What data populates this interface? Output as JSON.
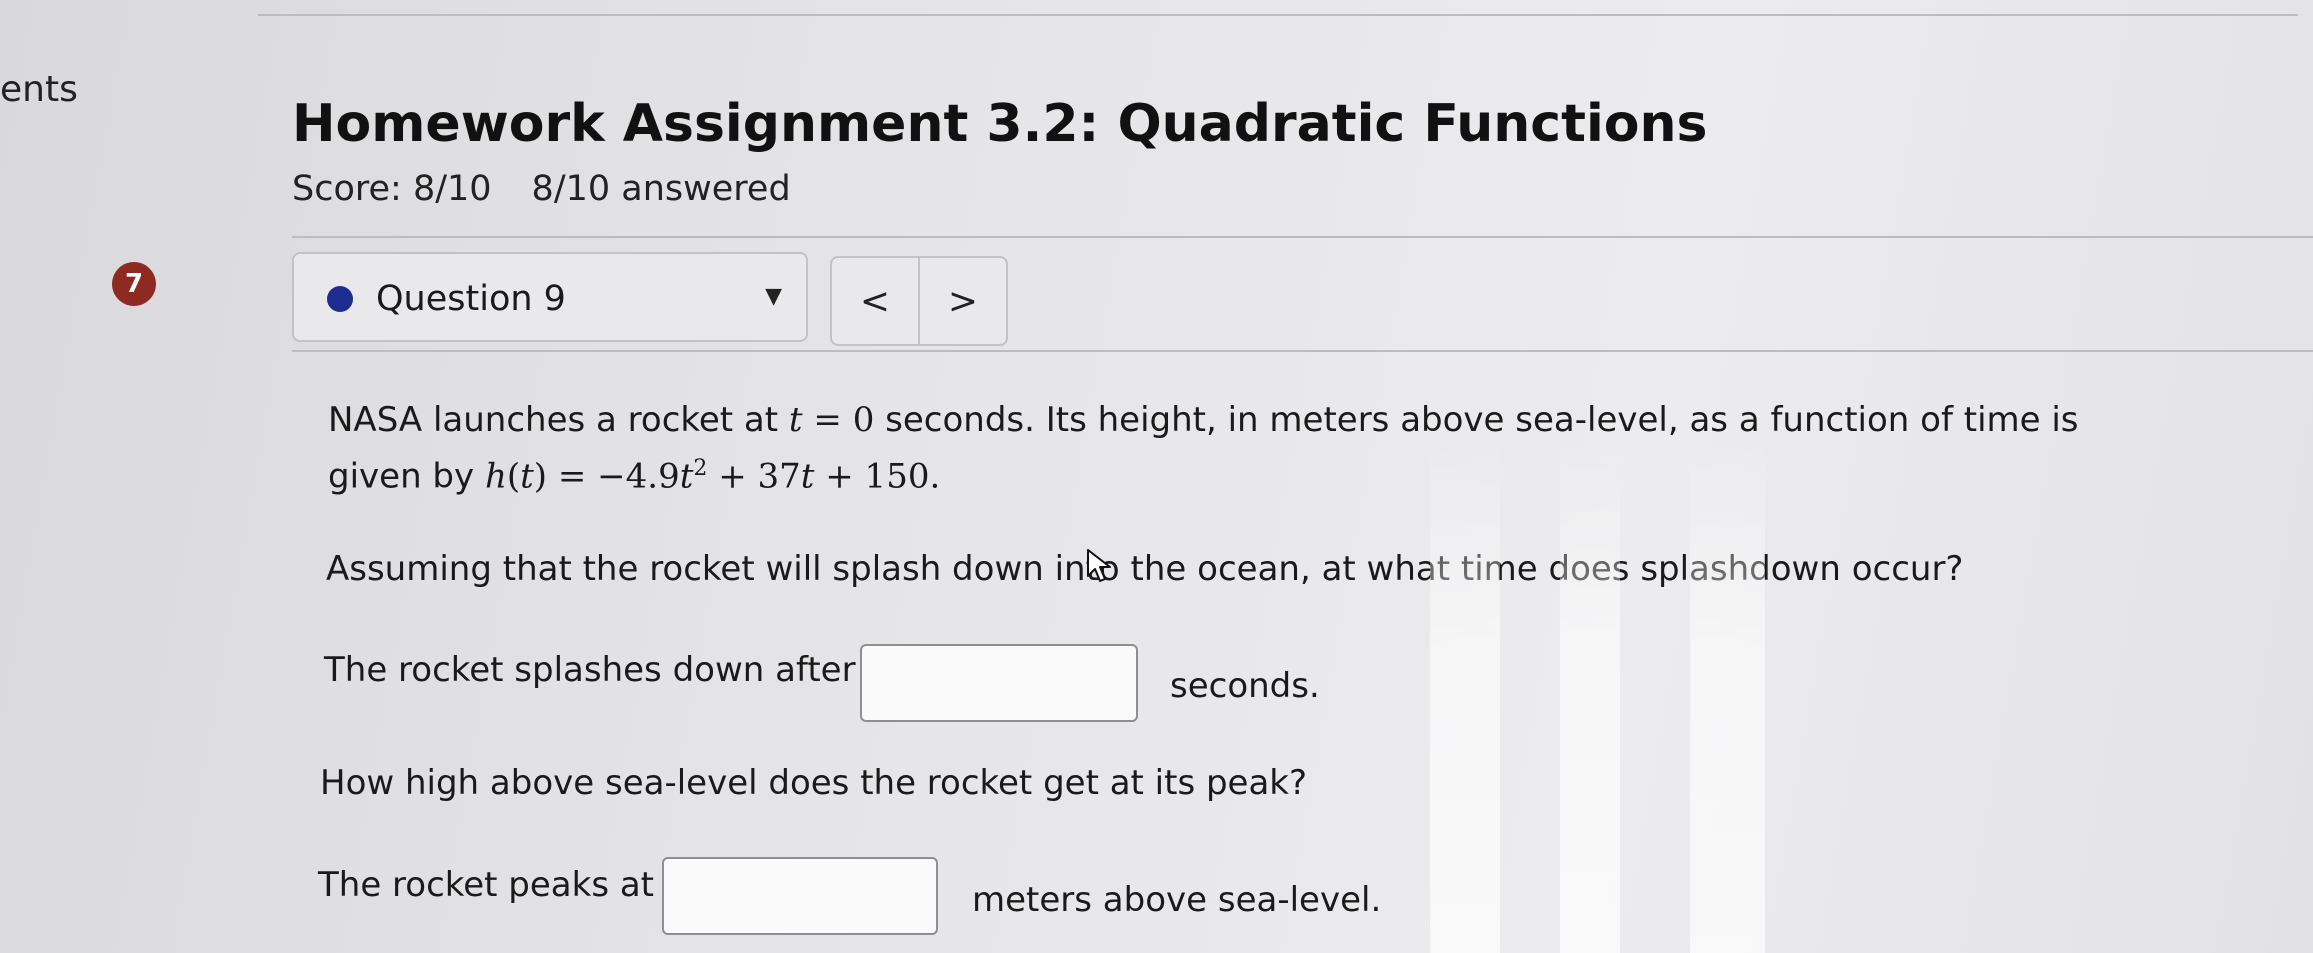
{
  "sidebar": {
    "fragment_text": "ents"
  },
  "assignment": {
    "title": "Homework Assignment 3.2: Quadratic Functions",
    "score": "Score: 8/10",
    "answered": "8/10 answered"
  },
  "question_nav": {
    "badge_number": "7",
    "selected_label": "Question 9",
    "prev_label": "<",
    "next_label": ">",
    "caret_icon": "triangle-down-icon"
  },
  "problem": {
    "intro_a": "NASA launches a rocket at",
    "intro_var": "t",
    "intro_eq": " = 0",
    "intro_b": " seconds. Its height, in meters above sea-level, as a function of time is",
    "intro_c": "given by",
    "fn_h": "h",
    "fn_open": "(",
    "fn_t": "t",
    "fn_close": ")",
    "fn_rhs_a": " = −4.9",
    "fn_rhs_t": "t",
    "fn_exp": "2",
    "fn_rhs_b": " + 37",
    "fn_rhs_t2": "t",
    "fn_rhs_c": " + 150.",
    "question_1": "Assuming that the rocket will splash down into the ocean, at what time does splashdown occur?",
    "answer_1_prefix": "The rocket splashes down after",
    "answer_1_value": "",
    "answer_1_suffix": "seconds.",
    "question_2": "How high above sea-level does the rocket get at its peak?",
    "answer_2_prefix": "The rocket peaks at",
    "answer_2_value": "",
    "answer_2_suffix": "meters above sea-level."
  },
  "colors": {
    "badge": "#8e2a22",
    "status_dot": "#1d2c8f"
  }
}
